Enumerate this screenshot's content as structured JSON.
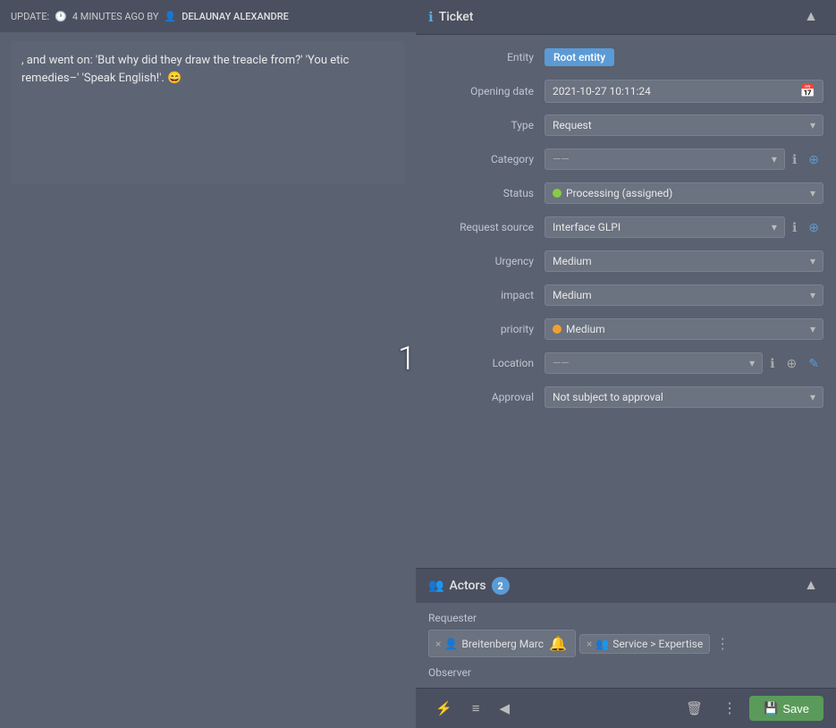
{
  "left": {
    "update_label": "UPDATE:",
    "time_ago": "4 MINUTES AGO BY",
    "by_label": "BY",
    "username": "DELAUNAY ALEXANDRE",
    "content_text": ", and went on: 'But why did they draw the treacle from?' 'You etic remedies–' 'Speak English!'. 😄"
  },
  "number": "1",
  "ticket": {
    "section_title": "Ticket",
    "chevron_label": "▲",
    "fields": {
      "entity_label": "Entity",
      "entity_value": "Root entity",
      "opening_date_label": "Opening date",
      "opening_date_value": "2021-10-27 10:11:24",
      "type_label": "Type",
      "type_value": "Request",
      "category_label": "Category",
      "category_value": "——",
      "status_label": "Status",
      "status_value": "Processing (assigned)",
      "request_source_label": "Request source",
      "request_source_value": "Interface GLPI",
      "urgency_label": "Urgency",
      "urgency_value": "Medium",
      "impact_label": "impact",
      "impact_value": "Medium",
      "priority_label": "priority",
      "priority_value": "Medium",
      "location_label": "Location",
      "location_value": "——",
      "approval_label": "Approval",
      "approval_value": "Not subject to approval"
    }
  },
  "actors": {
    "section_title": "Actors",
    "count": "2",
    "requester_label": "Requester",
    "requester_tags": [
      {
        "name": "Breitenberg Marc",
        "type": "person"
      },
      {
        "name": "Service > Expertise",
        "type": "group"
      }
    ],
    "observer_label": "Observer"
  },
  "toolbar": {
    "filter_icon": "⚡",
    "list_icon": "≡",
    "arrow_icon": "◀",
    "trash_icon": "🗑",
    "more_icon": "⋮",
    "save_label": "Save",
    "save_icon": "💾"
  }
}
